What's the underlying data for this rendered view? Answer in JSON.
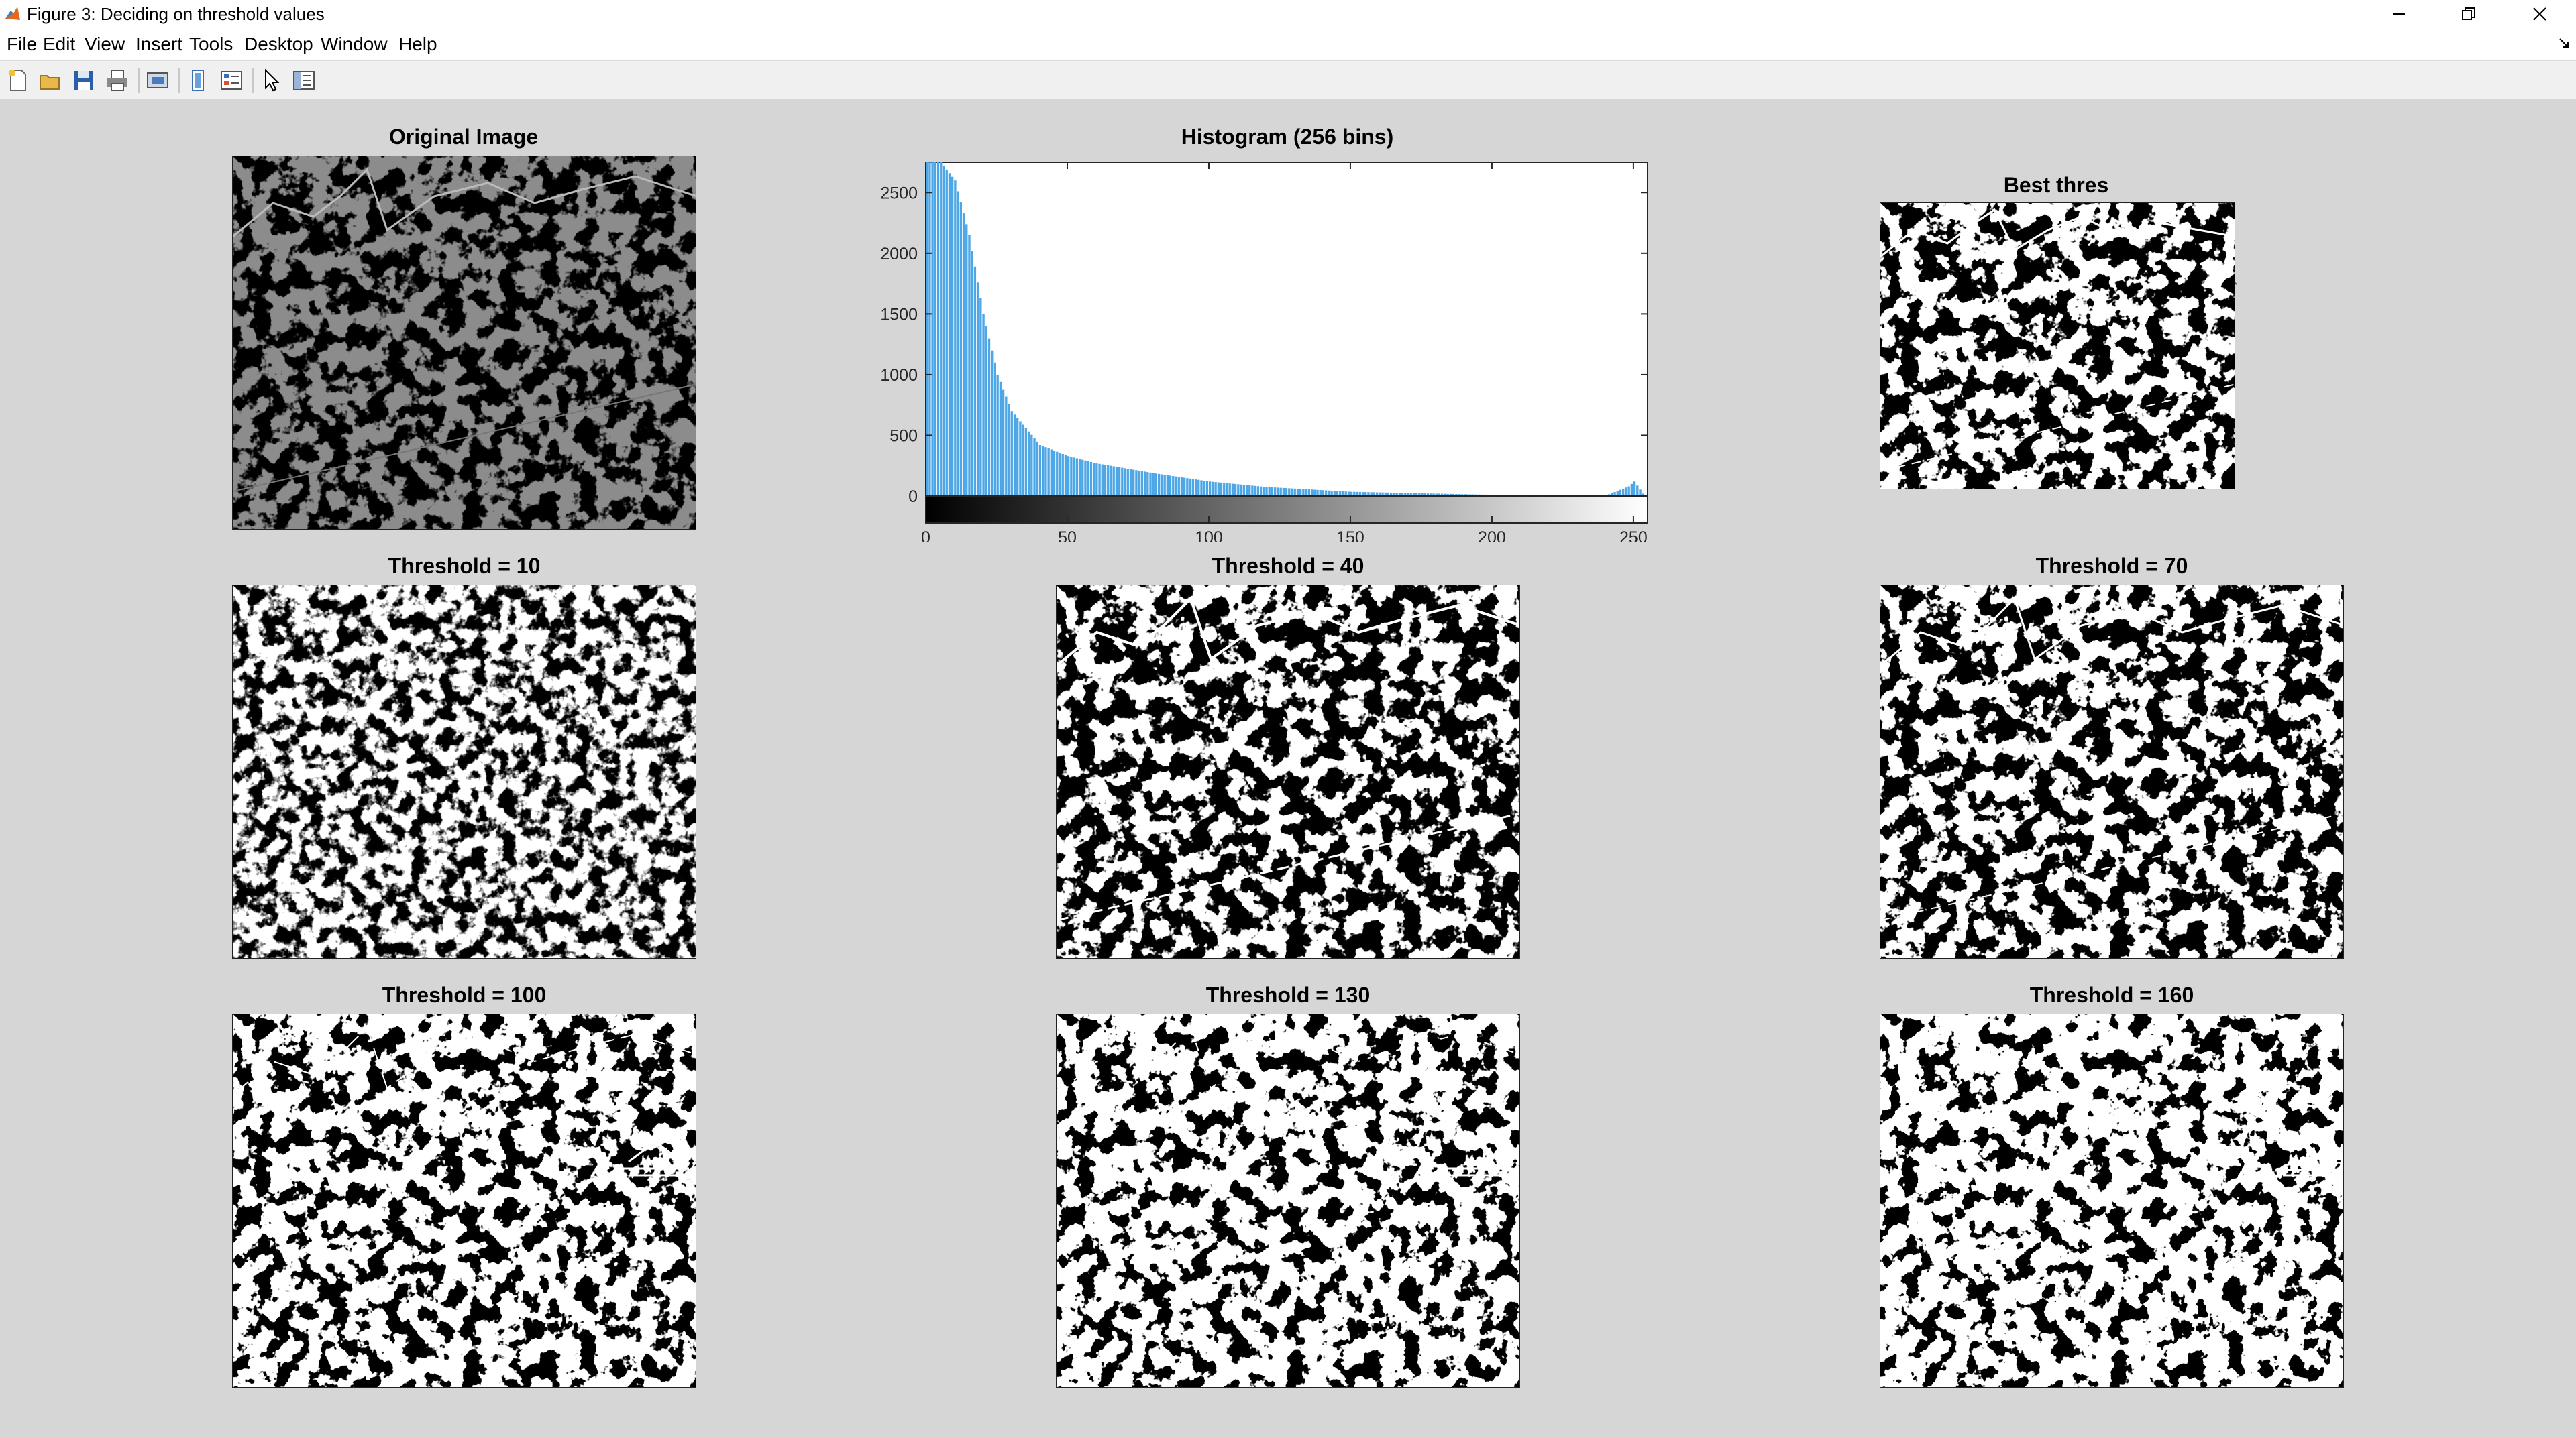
{
  "window": {
    "title": "Figure 3: Deciding on threshold values",
    "controls": [
      "minimize",
      "restore",
      "close"
    ]
  },
  "menu": [
    "File",
    "Edit",
    "View",
    "Insert",
    "Tools",
    "Desktop",
    "Window",
    "Help"
  ],
  "toolbar_icons": [
    "new-figure-icon",
    "open-file-icon",
    "save-icon",
    "print-icon",
    "export-icon",
    "link-plot-icon",
    "insert-colorbar-icon",
    "insert-legend-icon",
    "edit-plot-icon",
    "property-inspector-icon"
  ],
  "axes_toolbar_icons": [
    "brush-icon",
    "datatip-icon",
    "pan-icon",
    "zoom-in-icon",
    "zoom-out-icon",
    "home-icon"
  ],
  "panels": {
    "original": {
      "title": "Original Image"
    },
    "histogram": {
      "title": "Histogram (256 bins)"
    },
    "best": {
      "title": "Best thres"
    },
    "t10": {
      "title": "Threshold = 10"
    },
    "t40": {
      "title": "Threshold = 40"
    },
    "t70": {
      "title": "Threshold = 70"
    },
    "t100": {
      "title": "Threshold = 100"
    },
    "t130": {
      "title": "Threshold = 130"
    },
    "t160": {
      "title": "Threshold = 160"
    }
  },
  "chart_data": {
    "type": "bar",
    "title": "Histogram (256 bins)",
    "xlabel": "",
    "ylabel": "",
    "xlim": [
      0,
      255
    ],
    "ylim": [
      0,
      2750
    ],
    "x_ticks": [
      0,
      50,
      100,
      150,
      200,
      250
    ],
    "y_ticks": [
      0,
      500,
      1000,
      1500,
      2000,
      2500
    ],
    "bar_color": "#4da6e6",
    "grid": false,
    "colorbar": "gray",
    "bins_summary": [
      {
        "x": 0,
        "y": 2750
      },
      {
        "x": 5,
        "y": 2750
      },
      {
        "x": 10,
        "y": 2600
      },
      {
        "x": 15,
        "y": 2150
      },
      {
        "x": 20,
        "y": 1500
      },
      {
        "x": 25,
        "y": 1000
      },
      {
        "x": 30,
        "y": 700
      },
      {
        "x": 40,
        "y": 420
      },
      {
        "x": 50,
        "y": 330
      },
      {
        "x": 60,
        "y": 270
      },
      {
        "x": 80,
        "y": 190
      },
      {
        "x": 100,
        "y": 120
      },
      {
        "x": 120,
        "y": 75
      },
      {
        "x": 150,
        "y": 35
      },
      {
        "x": 200,
        "y": 10
      },
      {
        "x": 240,
        "y": 5
      },
      {
        "x": 248,
        "y": 80
      },
      {
        "x": 250,
        "y": 120
      },
      {
        "x": 253,
        "y": 20
      }
    ]
  },
  "colors": {
    "figure_bg": "#d6d6d6",
    "histogram_bar": "#4da6e6"
  }
}
